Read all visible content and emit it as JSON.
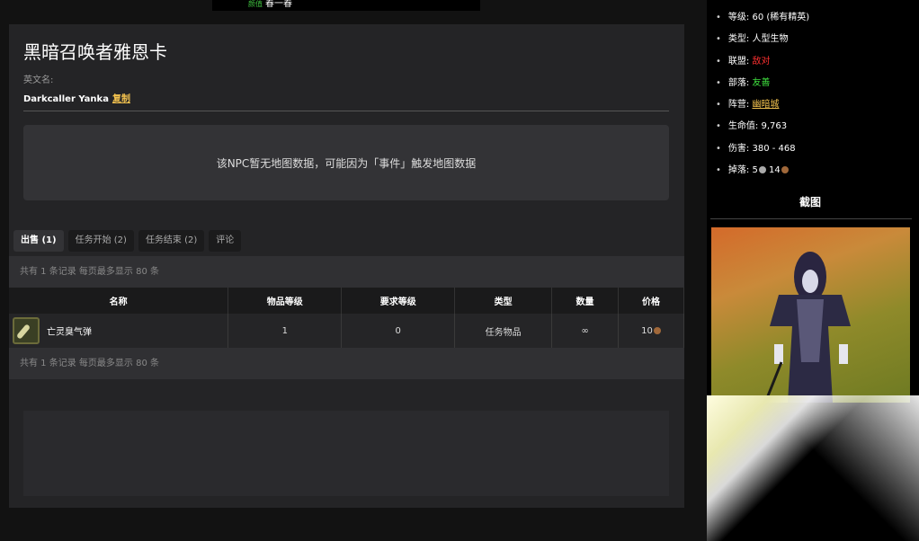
{
  "topbar": {
    "tag": "颜值",
    "text": "春一春"
  },
  "npc": {
    "title": "黑暗召唤者雅恩卡",
    "en_label": "英文名:",
    "en_name": "Darkcaller Yanka",
    "copy_label": "复制",
    "map_notice": "该NPC暂无地图数据，可能因为「事件」触发地图数据"
  },
  "tabs": [
    {
      "label": "出售 (1)",
      "active": true
    },
    {
      "label": "任务开始 (2)",
      "active": false
    },
    {
      "label": "任务结束 (2)",
      "active": false
    },
    {
      "label": "评论",
      "active": false
    }
  ],
  "records_text": "共有 1 条记录 每页最多显示 80 条",
  "table": {
    "headers": [
      "名称",
      "物品等级",
      "要求等级",
      "类型",
      "数量",
      "价格"
    ],
    "rows": [
      {
        "name": "亡灵臭气弹",
        "item_level": "1",
        "req_level": "0",
        "type": "任务物品",
        "qty": "∞",
        "price": "10",
        "icon": "item-bomb-icon"
      }
    ]
  },
  "info": {
    "level_label": "等级:",
    "level_value": "60 (稀有精英)",
    "type_label": "类型:",
    "type_value": "人型生物",
    "alliance_label": "联盟:",
    "alliance_value": "敌对",
    "horde_label": "部落:",
    "horde_value": "友善",
    "faction_label": "阵营:",
    "faction_value": "幽暗城",
    "hp_label": "生命值:",
    "hp_value": "9,763",
    "dmg_label": "伤害:",
    "dmg_value": "380 - 468",
    "loot_label": "掉落:",
    "loot_silver": "5",
    "loot_copper": "14"
  },
  "screenshot_title": "截图",
  "colors": {
    "hostile": "#ff3030",
    "friendly": "#3fdf3f",
    "link": "#f2c14e",
    "panel": "#242426"
  }
}
